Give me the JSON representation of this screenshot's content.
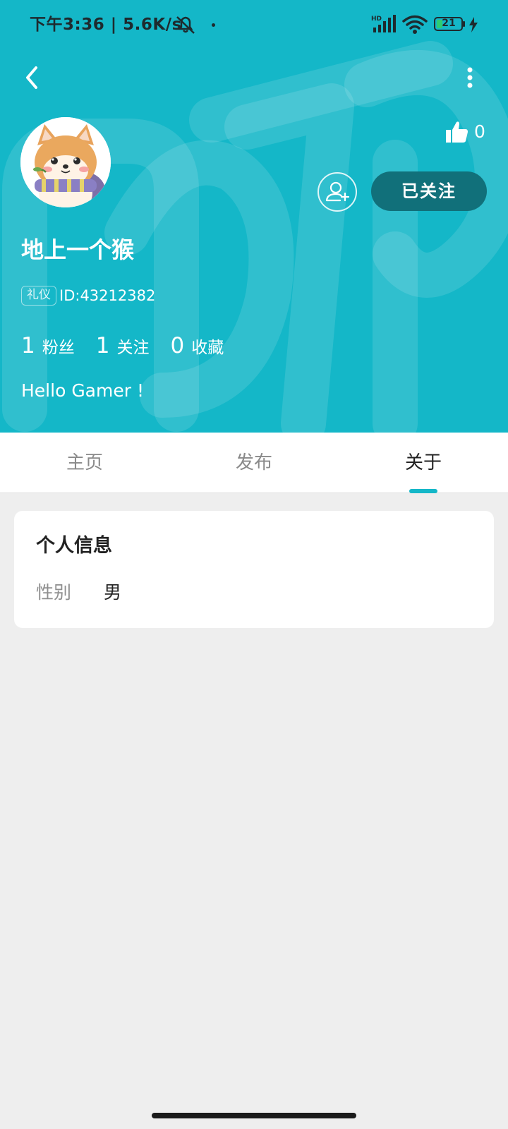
{
  "status_bar": {
    "time_speed": "下午3:36 | 5.6K/s",
    "signal_label": "HD",
    "battery_level": "21"
  },
  "header": {
    "background_color": "#14b7c8",
    "like_count": "0",
    "follow_label": "已关注",
    "username": "地上一个猴",
    "badge_label": "礼仪",
    "user_id": "ID:43212382",
    "stats": [
      {
        "num": "1",
        "label": "粉丝"
      },
      {
        "num": "1",
        "label": "关注"
      },
      {
        "num": "0",
        "label": "收藏"
      }
    ],
    "bio": "Hello Gamer !"
  },
  "tabs": [
    {
      "label": "主页",
      "active": false
    },
    {
      "label": "发布",
      "active": false
    },
    {
      "label": "关于",
      "active": true
    }
  ],
  "info_card": {
    "title": "个人信息",
    "gender_label": "性别",
    "gender_value": "男"
  }
}
